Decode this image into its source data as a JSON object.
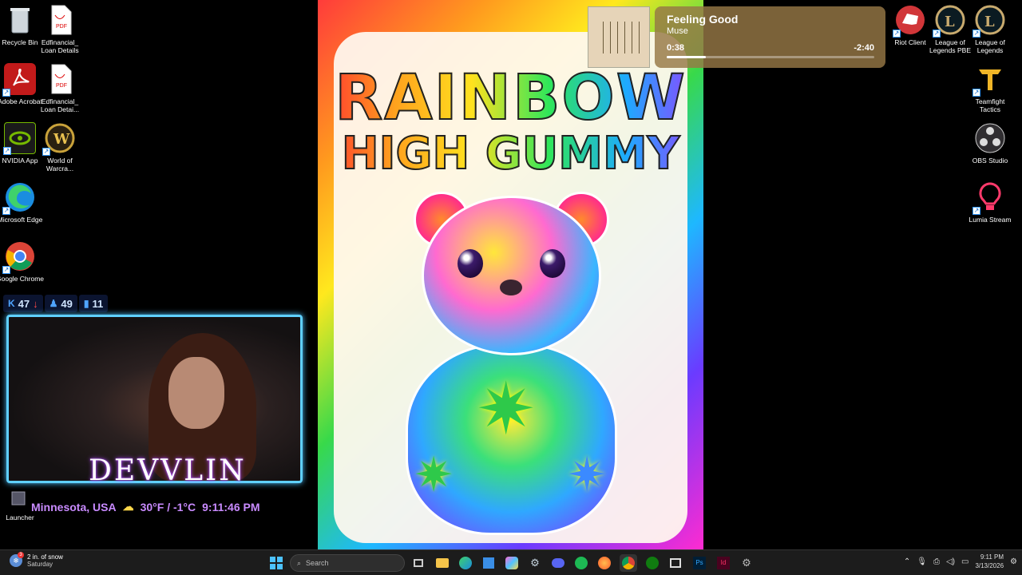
{
  "desktop": {
    "left_icons": [
      {
        "label": "Recycle Bin",
        "icon": "recycle-bin-icon"
      },
      {
        "label": "Edfinancial_ Loan Details",
        "icon": "pdf-file-icon"
      },
      {
        "label": "Adobe Acrobat",
        "icon": "adobe-acrobat-icon"
      },
      {
        "label": "Edfinancial_ Loan Detai...",
        "icon": "pdf-file-icon"
      },
      {
        "label": "NVIDIA App",
        "icon": "nvidia-icon"
      },
      {
        "label": "World of Warcra...",
        "icon": "world-of-warcraft-icon"
      },
      {
        "label": "Microsoft Edge",
        "icon": "edge-icon"
      },
      {
        "label": "Google Chrome",
        "icon": "chrome-icon"
      },
      {
        "label": "Launcher",
        "icon": "launcher-icon"
      }
    ],
    "right_icons": [
      {
        "label": "Riot Client",
        "icon": "riot-client-icon"
      },
      {
        "label": "League of Legends PBE",
        "icon": "league-pbe-icon"
      },
      {
        "label": "League of Legends",
        "icon": "league-icon"
      },
      {
        "label": "Teamfight Tactics",
        "icon": "tft-icon"
      },
      {
        "label": "OBS Studio",
        "icon": "obs-icon"
      },
      {
        "label": "Lumia Stream",
        "icon": "lumia-icon"
      }
    ]
  },
  "artwork": {
    "line1": "RAINBOW",
    "line2": "HIGH GUMMY"
  },
  "now_playing": {
    "song": "Feeling Good",
    "artist": "Muse",
    "elapsed": "0:38",
    "remaining": "-2:40",
    "progress_fraction": 0.19
  },
  "stream_overlay": {
    "stats": [
      {
        "icon": "kick-icon",
        "value": "47"
      },
      {
        "icon": "viewer-icon",
        "value": "49"
      },
      {
        "icon": "chart-icon",
        "value": "11"
      }
    ],
    "handle": "DEVVLIN",
    "location": "Minnesota, USA",
    "temperature": "30°F / -1°C",
    "time": "9:11:46 PM"
  },
  "taskbar": {
    "weather_line1": "2 in. of snow",
    "weather_line2": "Saturday",
    "weather_badge": "3",
    "search_placeholder": "Search",
    "clock_time": "9:11 PM",
    "clock_date": "3/13/2026"
  },
  "colors": {
    "taskbar_bg": "#1c1c1c",
    "cam_border": "#5fd0ff",
    "handle_glow": "#b04bff",
    "np_card": "#96784a"
  }
}
